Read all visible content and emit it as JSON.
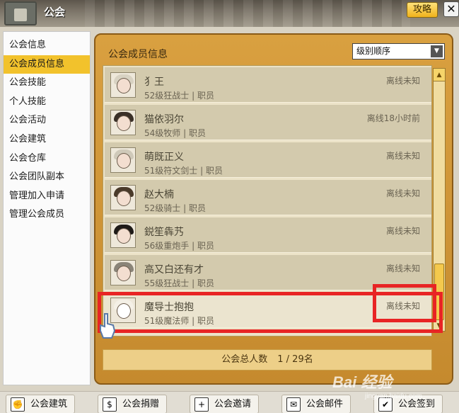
{
  "window": {
    "title": "公会",
    "strategy_label": "攻略",
    "close_label": "✕"
  },
  "sidebar": {
    "items": [
      {
        "label": "公会信息"
      },
      {
        "label": "公会成员信息",
        "active": true
      },
      {
        "label": "公会技能"
      },
      {
        "label": "个人技能"
      },
      {
        "label": "公会活动"
      },
      {
        "label": "公会建筑"
      },
      {
        "label": "公会仓库"
      },
      {
        "label": "公会团队副本"
      },
      {
        "label": "管理加入申请"
      },
      {
        "label": "管理公会成员"
      }
    ]
  },
  "panel": {
    "title": "公会成员信息",
    "sort": {
      "selected": "级别顺序"
    }
  },
  "members": [
    {
      "name": "犭王",
      "info": "52级狂战士 | 职员",
      "status": "离线未知"
    },
    {
      "name": "猫依羽尔",
      "info": "54级牧师 | 职员",
      "status": "离线18小时前"
    },
    {
      "name": "萌既正义",
      "info": "51级符文剑士 | 职员",
      "status": "离线未知"
    },
    {
      "name": "赵大楠",
      "info": "52级骑士 | 职员",
      "status": "离线未知"
    },
    {
      "name": "鋭笙犇艿",
      "info": "56级重炮手 | 职员",
      "status": "离线未知"
    },
    {
      "name": "高又白还有才",
      "info": "55级狂战士 | 职员",
      "status": "离线未知"
    },
    {
      "name": "魔导士抱抱",
      "info": "51级魔法师 | 职员",
      "status": "离线未知",
      "highlighted": true
    }
  ],
  "total": {
    "label": "公会总人数",
    "count": "1 / 29名"
  },
  "bottom_toolbar": {
    "buttons": [
      {
        "label": "公会建筑",
        "icon": "fist-icon"
      },
      {
        "label": "公会捐赠",
        "icon": "donation-icon"
      },
      {
        "label": "公会邀请",
        "icon": "plus-icon"
      },
      {
        "label": "公会邮件",
        "icon": "mail-icon"
      },
      {
        "label": "公会签到",
        "icon": "checkmark-icon"
      }
    ]
  },
  "watermark": {
    "brand": "Bai 经验",
    "url": "jingyan.baidu.com"
  },
  "colors": {
    "accent": "#f2c22c",
    "panel_gold": "#d9a040",
    "highlight_red": "#e82424"
  }
}
